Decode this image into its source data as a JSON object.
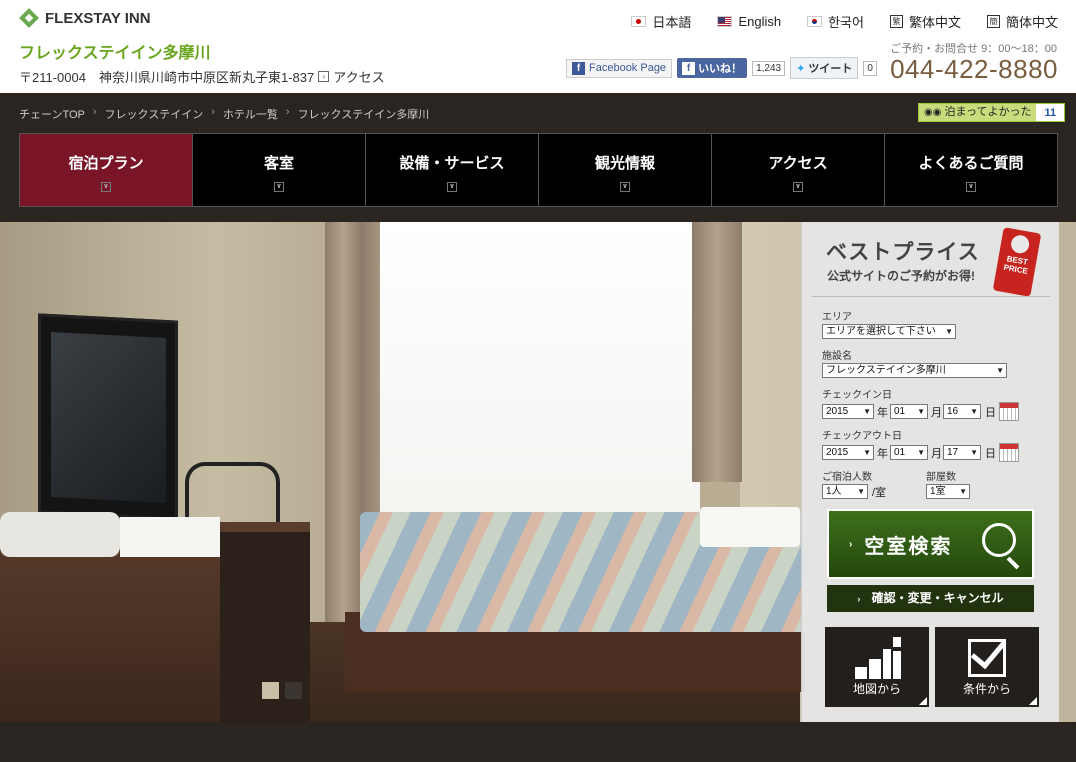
{
  "header": {
    "logo_text": "FLEXSTAY INN",
    "hotel_name": "フレックステイイン多摩川",
    "address": "〒211-0004　神奈川県川崎市中原区新丸子東1-837",
    "access_label": "アクセス",
    "languages": [
      {
        "label": "日本語",
        "icon": "flag-jp"
      },
      {
        "label": "English",
        "icon": "flag-us"
      },
      {
        "label": "한국어",
        "icon": "flag-kr"
      },
      {
        "label": "繁体中文",
        "icon": "badge-traditional",
        "badge": "繁"
      },
      {
        "label": "簡体中文",
        "icon": "badge-simplified",
        "badge": "簡"
      }
    ],
    "social": {
      "facebook_page": "Facebook Page",
      "like_label": "いいね！",
      "like_count": "1,243",
      "tweet_label": "ツイート",
      "tweet_count": "0"
    },
    "contact_label": "ご予約・お問合せ 9：00～18：00",
    "phone": "044-422-8880"
  },
  "breadcrumb": [
    "チェーンTOP",
    "フレックステイイン",
    "ホテル一覧",
    "フレックステイイン多摩川"
  ],
  "tripadvisor": {
    "label": "泊まってよかった",
    "count": "11"
  },
  "nav": [
    {
      "label": "宿泊プラン",
      "active": true
    },
    {
      "label": "客室",
      "active": false
    },
    {
      "label": "設備・サービス",
      "active": false
    },
    {
      "label": "観光情報",
      "active": false
    },
    {
      "label": "アクセス",
      "active": false
    },
    {
      "label": "よくあるご質問",
      "active": false
    }
  ],
  "slider": {
    "total_dots": 2,
    "active_index": 0
  },
  "booking": {
    "title": "ベストプライス",
    "subtitle": "公式サイトのご予約がお得!",
    "tag_text": "BEST PRICE",
    "area_label": "エリア",
    "area_value": "エリアを選択して下さい",
    "facility_label": "施設名",
    "facility_value": "フレックステイイン多摩川",
    "checkin_label": "チェックイン日",
    "checkin": {
      "year": "2015",
      "month": "01",
      "day": "16"
    },
    "checkout_label": "チェックアウト日",
    "checkout": {
      "year": "2015",
      "month": "01",
      "day": "17"
    },
    "unit_year": "年",
    "unit_month": "月",
    "unit_day": "日",
    "guests_label": "ご宿泊人数",
    "guests_value": "1人",
    "guests_unit": "/室",
    "rooms_label": "部屋数",
    "rooms_value": "1室",
    "search_label": "空室検索",
    "confirm_label": "確認・変更・キャンセル",
    "map_label": "地図から",
    "condition_label": "条件から"
  },
  "colors": {
    "accent_green": "#6aa61d",
    "nav_active": "#7a1528",
    "search_green": "#2f5a12",
    "phone_brown": "#7a5c3e"
  }
}
